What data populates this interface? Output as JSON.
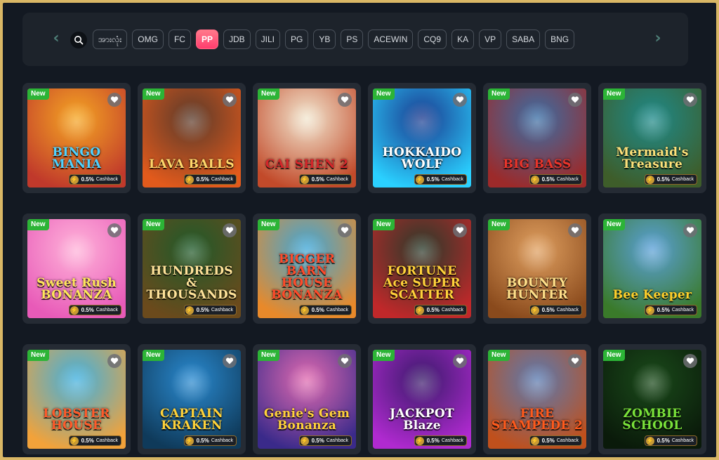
{
  "providers": [
    {
      "label": "အားလုံး",
      "active": false
    },
    {
      "label": "OMG",
      "active": false
    },
    {
      "label": "FC",
      "active": false
    },
    {
      "label": "PP",
      "active": true
    },
    {
      "label": "JDB",
      "active": false
    },
    {
      "label": "JILI",
      "active": false
    },
    {
      "label": "PG",
      "active": false
    },
    {
      "label": "YB",
      "active": false
    },
    {
      "label": "PS",
      "active": false
    },
    {
      "label": "ACEWIN",
      "active": false
    },
    {
      "label": "CQ9",
      "active": false
    },
    {
      "label": "KA",
      "active": false
    },
    {
      "label": "VP",
      "active": false
    },
    {
      "label": "SABA",
      "active": false
    },
    {
      "label": "BNG",
      "active": false
    }
  ],
  "icons": {
    "prev": "chevron-left-icon",
    "next": "chevron-right-icon",
    "search": "search-icon",
    "favorite": "heart-icon",
    "cashback": "lightning-icon"
  },
  "badge_label": "New",
  "cashback_percent": "0.5%",
  "cashback_label": "Cashback",
  "games": [
    {
      "title": "BINGO MANIA",
      "bg1": "#f5a623",
      "bg2": "#c0392b",
      "titleColor": "#4fd2ff"
    },
    {
      "title": "LAVA BALLS",
      "bg1": "#5a3a2a",
      "bg2": "#e25a1c",
      "titleColor": "#ffd86b"
    },
    {
      "title": "CAI SHEN 2",
      "bg1": "#f2e7d0",
      "bg2": "#c24a2a",
      "titleColor": "#d4262a"
    },
    {
      "title": "HOKKAIDO WOLF",
      "bg1": "#1b3a8f",
      "bg2": "#2ad0ff",
      "titleColor": "#ffffff"
    },
    {
      "title": "BIG BASS",
      "bg1": "#3a6ea5",
      "bg2": "#9c2a2a",
      "titleColor": "#e8342a"
    },
    {
      "title": "Mermaid's Treasure",
      "bg1": "#1e8a8a",
      "bg2": "#3e5d2a",
      "titleColor": "#ffe27a"
    },
    {
      "title": "Sweet Rush BONANZA",
      "bg1": "#ffb3d9",
      "bg2": "#e85ab8",
      "titleColor": "#ffe65a"
    },
    {
      "title": "HUNDREDS & THOUSANDS",
      "bg1": "#1f5a2a",
      "bg2": "#6b4a1c",
      "titleColor": "#ffe39a"
    },
    {
      "title": "BIGGER BARN HOUSE BONANZA",
      "bg1": "#3fa7d8",
      "bg2": "#e8892a",
      "titleColor": "#ff4a2a"
    },
    {
      "title": "FORTUNE Ace SUPER SCATTER",
      "bg1": "#2a3a2a",
      "bg2": "#c0282a",
      "titleColor": "#ffd23a"
    },
    {
      "title": "BOUNTY HUNTER",
      "bg1": "#e0a060",
      "bg2": "#8a4a1c",
      "titleColor": "#ffe08a"
    },
    {
      "title": "Bee Keeper",
      "bg1": "#5aa0d8",
      "bg2": "#3a7a2a",
      "titleColor": "#ffcf2a"
    },
    {
      "title": "LOBSTER HOUSE",
      "bg1": "#3fb0e0",
      "bg2": "#f2a23a",
      "titleColor": "#ff5a2a"
    },
    {
      "title": "CAPTAIN KRAKEN",
      "bg1": "#2a8ad0",
      "bg2": "#0f3a5a",
      "titleColor": "#ffd23a"
    },
    {
      "title": "Genie's Gem Bonanza",
      "bg1": "#e06ab0",
      "bg2": "#3a2a8a",
      "titleColor": "#ffd23a"
    },
    {
      "title": "JACKPOT Blaze",
      "bg1": "#3a1a6a",
      "bg2": "#b02ad0",
      "titleColor": "#ffffff"
    },
    {
      "title": "FIRE STAMPEDE 2",
      "bg1": "#5a7ab0",
      "bg2": "#c0501c",
      "titleColor": "#ff5a1c"
    },
    {
      "title": "ZOMBIE SCHOOL",
      "bg1": "#1a4a1a",
      "bg2": "#0a1a0a",
      "titleColor": "#7ae23a"
    }
  ]
}
